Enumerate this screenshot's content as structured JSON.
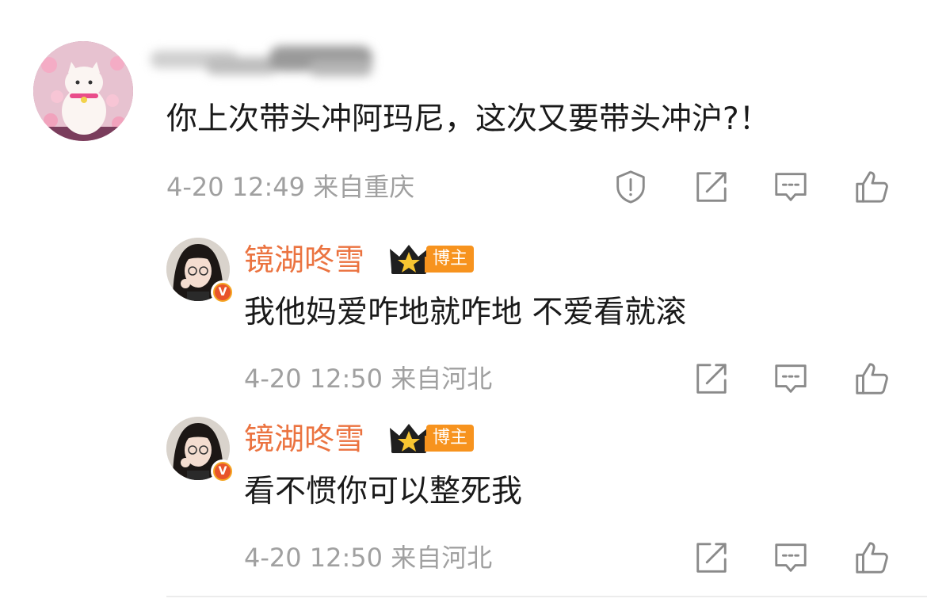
{
  "comment": {
    "text": "你上次带头冲阿玛尼，这次又要带头冲沪?！",
    "timestamp": "4-20 12:49",
    "location": "来自重庆",
    "actions": [
      "report-icon",
      "repost-icon",
      "comment-icon",
      "like-icon"
    ]
  },
  "replies": [
    {
      "author": "镜湖咚雪",
      "badge_label": "博主",
      "text": "我他妈爱咋地就咋地 不爱看就滚",
      "timestamp": "4-20 12:50",
      "location": "来自河北",
      "verified_mark": "V"
    },
    {
      "author": "镜湖咚雪",
      "badge_label": "博主",
      "text": "看不惯你可以整死我",
      "timestamp": "4-20 12:50",
      "location": "来自河北",
      "verified_mark": "V"
    }
  ],
  "colors": {
    "author_name": "#eb7340",
    "meta_text": "#a0a0a0",
    "badge_bg": "#f7931e",
    "icon_stroke": "#8a8a8a"
  }
}
